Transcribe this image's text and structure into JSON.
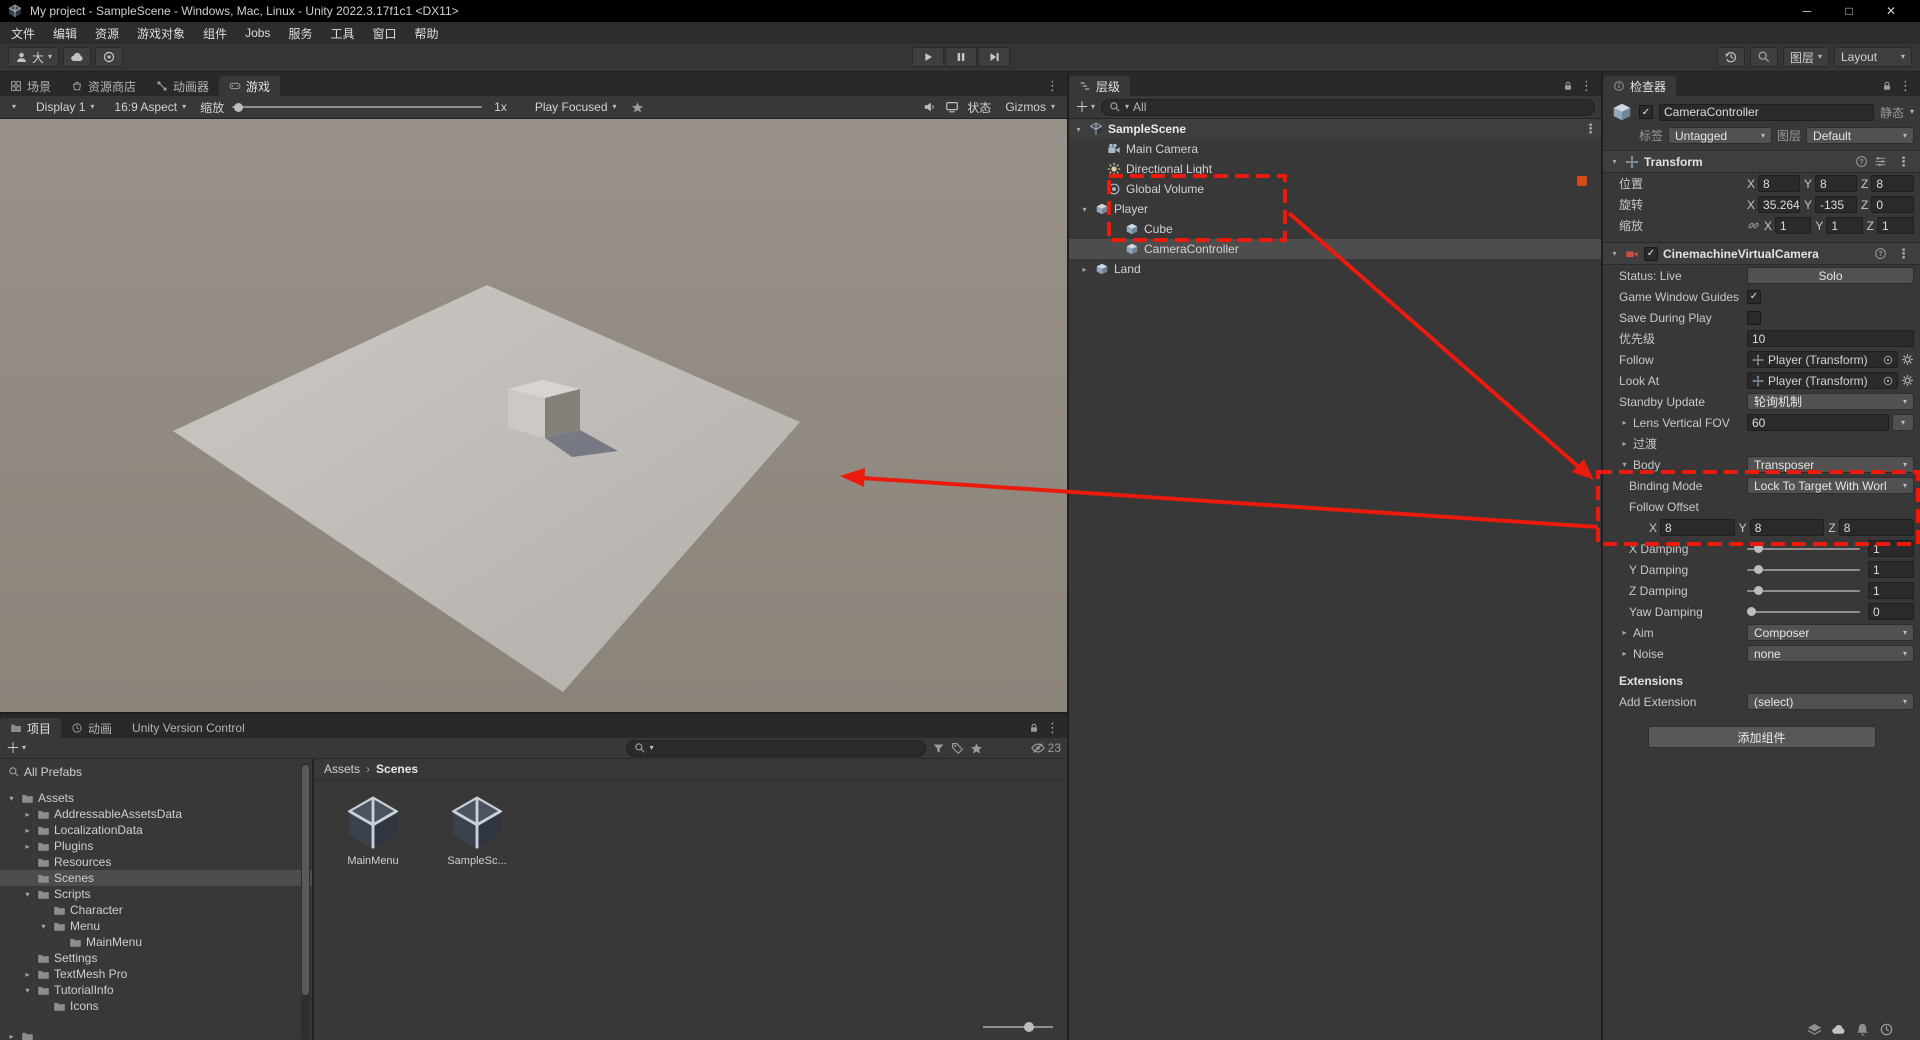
{
  "window": {
    "title": "My project - SampleScene - Windows, Mac, Linux - Unity 2022.3.17f1c1 <DX11>"
  },
  "menu": {
    "items": [
      "文件",
      "编辑",
      "资源",
      "游戏对象",
      "组件",
      "Jobs",
      "服务",
      "工具",
      "窗口",
      "帮助"
    ]
  },
  "toolbar": {
    "account_label": "大",
    "layers_label": "图层",
    "layout_label": "Layout"
  },
  "view_tabs": {
    "scene": "场景",
    "asset_store": "资源商店",
    "animator": "动画器",
    "game": "游戏"
  },
  "game_toolbar": {
    "display": "Display 1",
    "aspect": "16:9 Aspect",
    "scale_label": "缩放",
    "scale_value": "1x",
    "play_focused": "Play Focused",
    "stats_label": "状态",
    "gizmos_label": "Gizmos"
  },
  "hierarchy": {
    "tab": "层级",
    "search_text": "All",
    "items": [
      {
        "label": "SampleScene"
      },
      {
        "label": "Main Camera"
      },
      {
        "label": "Directional Light"
      },
      {
        "label": "Global Volume"
      },
      {
        "label": "Player"
      },
      {
        "label": "Cube"
      },
      {
        "label": "CameraController"
      },
      {
        "label": "Land"
      }
    ]
  },
  "inspector": {
    "tab": "检查器",
    "axes": {
      "x": "X",
      "y": "Y",
      "z": "Z"
    },
    "game_object": {
      "name": "CameraController",
      "static_label": "静态",
      "tag_label": "标签",
      "tag_value": "Untagged",
      "layer_label": "图层",
      "layer_value": "Default"
    },
    "transform": {
      "title": "Transform",
      "position_label": "位置",
      "rotation_label": "旋转",
      "scale_label": "缩放",
      "position": {
        "x": "8",
        "y": "8",
        "z": "8"
      },
      "rotation": {
        "x": "35.264",
        "y": "-135",
        "z": "0"
      },
      "scale": {
        "x": "1",
        "y": "1",
        "z": "1"
      }
    },
    "cinemachine": {
      "title": "CinemachineVirtualCamera",
      "status_label": "Status: Live",
      "solo_label": "Solo",
      "guides_label": "Game Window Guides",
      "save_label": "Save During Play",
      "priority_label": "优先级",
      "priority_value": "10",
      "follow_label": "Follow",
      "follow_value": "Player (Transform)",
      "look_at_label": "Look At",
      "look_at_value": "Player (Transform)",
      "standby_label": "Standby Update",
      "standby_value": "轮询机制",
      "lens_label": "Lens Vertical FOV",
      "lens_value": "60",
      "transitions_label": "过渡",
      "body_label": "Body",
      "body_value": "Transposer",
      "binding_label": "Binding Mode",
      "binding_value": "Lock To Target With Worl",
      "offset_label": "Follow Offset",
      "offset": {
        "x": "8",
        "y": "8",
        "z": "8"
      },
      "x_damping_label": "X Damping",
      "x_damping_value": "1",
      "y_damping_label": "Y Damping",
      "y_damping_value": "1",
      "z_damping_label": "Z Damping",
      "z_damping_value": "1",
      "yaw_damping_label": "Yaw Damping",
      "yaw_damping_value": "0",
      "aim_label": "Aim",
      "aim_value": "Composer",
      "noise_label": "Noise",
      "noise_value": "none",
      "extensions_label": "Extensions",
      "add_extension_label": "Add Extension",
      "add_extension_value": "(select)"
    },
    "add_component_label": "添加组件"
  },
  "project": {
    "tabs": {
      "project": "项目",
      "animation": "动画",
      "version_control": "Unity Version Control"
    },
    "hidden_count": "23",
    "tree": [
      {
        "label": "All Prefabs"
      },
      {
        "label": "Assets"
      },
      {
        "label": "AddressableAssetsData"
      },
      {
        "label": "LocalizationData"
      },
      {
        "label": "Plugins"
      },
      {
        "label": "Resources"
      },
      {
        "label": "Scenes"
      },
      {
        "label": "Scripts"
      },
      {
        "label": "Character"
      },
      {
        "label": "Menu"
      },
      {
        "label": "MainMenu"
      },
      {
        "label": "Settings"
      },
      {
        "label": "TextMesh Pro"
      },
      {
        "label": "TutorialInfo"
      },
      {
        "label": "Icons"
      }
    ],
    "breadcrumb": {
      "root": "Assets",
      "current": "Scenes"
    },
    "assets": [
      {
        "name": "MainMenu"
      },
      {
        "name": "SampleSc..."
      }
    ]
  },
  "annotation": {
    "color": "#ea1a0c"
  }
}
